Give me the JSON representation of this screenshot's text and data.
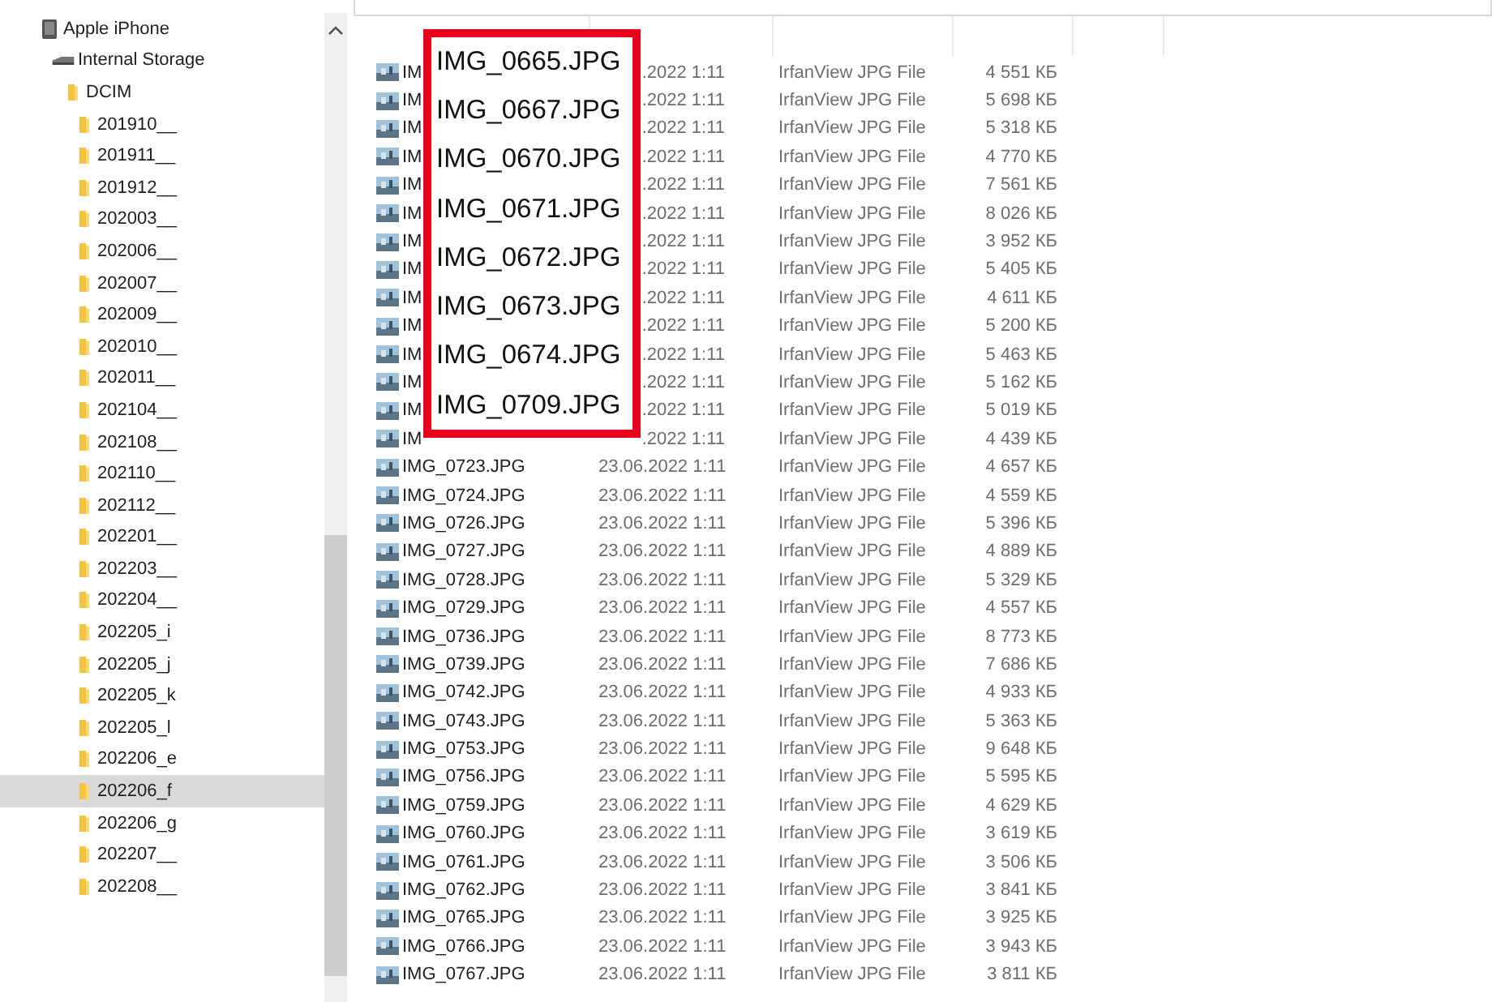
{
  "tree": [
    {
      "label": "Apple iPhone",
      "kind": "device",
      "selected": false,
      "children": [
        {
          "label": "Internal Storage",
          "kind": "drive",
          "selected": false,
          "children": [
            {
              "label": "DCIM",
              "kind": "folder",
              "selected": false,
              "children": [
                {
                  "label": "201910__",
                  "kind": "folder",
                  "selected": false
                },
                {
                  "label": "201911__",
                  "kind": "folder",
                  "selected": false
                },
                {
                  "label": "201912__",
                  "kind": "folder",
                  "selected": false
                },
                {
                  "label": "202003__",
                  "kind": "folder",
                  "selected": false
                },
                {
                  "label": "202006__",
                  "kind": "folder",
                  "selected": false
                },
                {
                  "label": "202007__",
                  "kind": "folder",
                  "selected": false
                },
                {
                  "label": "202009__",
                  "kind": "folder",
                  "selected": false
                },
                {
                  "label": "202010__",
                  "kind": "folder",
                  "selected": false
                },
                {
                  "label": "202011__",
                  "kind": "folder",
                  "selected": false
                },
                {
                  "label": "202104__",
                  "kind": "folder",
                  "selected": false
                },
                {
                  "label": "202108__",
                  "kind": "folder",
                  "selected": false
                },
                {
                  "label": "202110__",
                  "kind": "folder",
                  "selected": false
                },
                {
                  "label": "202112__",
                  "kind": "folder",
                  "selected": false
                },
                {
                  "label": "202201__",
                  "kind": "folder",
                  "selected": false
                },
                {
                  "label": "202203__",
                  "kind": "folder",
                  "selected": false
                },
                {
                  "label": "202204__",
                  "kind": "folder",
                  "selected": false
                },
                {
                  "label": "202205_i",
                  "kind": "folder",
                  "selected": false
                },
                {
                  "label": "202205_j",
                  "kind": "folder",
                  "selected": false
                },
                {
                  "label": "202205_k",
                  "kind": "folder",
                  "selected": false
                },
                {
                  "label": "202205_l",
                  "kind": "folder",
                  "selected": false
                },
                {
                  "label": "202206_e",
                  "kind": "folder",
                  "selected": false
                },
                {
                  "label": "202206_f",
                  "kind": "folder",
                  "selected": true
                },
                {
                  "label": "202206_g",
                  "kind": "folder",
                  "selected": false
                },
                {
                  "label": "202207__",
                  "kind": "folder",
                  "selected": false
                },
                {
                  "label": "202208__",
                  "kind": "folder",
                  "selected": false
                }
              ]
            }
          ]
        }
      ]
    }
  ],
  "files": [
    {
      "name": "IM",
      "modified": ".2022 1:11",
      "type": "IrfanView JPG File",
      "size": "4 551 КБ"
    },
    {
      "name": "IM",
      "modified": ".2022 1:11",
      "type": "IrfanView JPG File",
      "size": "5 698 КБ"
    },
    {
      "name": "IM",
      "modified": ".2022 1:11",
      "type": "IrfanView JPG File",
      "size": "5 318 КБ"
    },
    {
      "name": "IM",
      "modified": ".2022 1:11",
      "type": "IrfanView JPG File",
      "size": "4 770 КБ"
    },
    {
      "name": "IM",
      "modified": ".2022 1:11",
      "type": "IrfanView JPG File",
      "size": "7 561 КБ"
    },
    {
      "name": "IM",
      "modified": ".2022 1:11",
      "type": "IrfanView JPG File",
      "size": "8 026 КБ"
    },
    {
      "name": "IM",
      "modified": ".2022 1:11",
      "type": "IrfanView JPG File",
      "size": "3 952 КБ"
    },
    {
      "name": "IM",
      "modified": ".2022 1:11",
      "type": "IrfanView JPG File",
      "size": "5 405 КБ"
    },
    {
      "name": "IM",
      "modified": ".2022 1:11",
      "type": "IrfanView JPG File",
      "size": "4 611 КБ"
    },
    {
      "name": "IM",
      "modified": ".2022 1:11",
      "type": "IrfanView JPG File",
      "size": "5 200 КБ"
    },
    {
      "name": "IM",
      "modified": ".2022 1:11",
      "type": "IrfanView JPG File",
      "size": "5 463 КБ"
    },
    {
      "name": "IM",
      "modified": ".2022 1:11",
      "type": "IrfanView JPG File",
      "size": "5 162 КБ"
    },
    {
      "name": "IM",
      "modified": ".2022 1:11",
      "type": "IrfanView JPG File",
      "size": "5 019 КБ"
    },
    {
      "name": "IM",
      "modified": ".2022 1:11",
      "type": "IrfanView JPG File",
      "size": "4 439 КБ"
    },
    {
      "name": "IMG_0723.JPG",
      "modified": "23.06.2022 1:11",
      "type": "IrfanView JPG File",
      "size": "4 657 КБ"
    },
    {
      "name": "IMG_0724.JPG",
      "modified": "23.06.2022 1:11",
      "type": "IrfanView JPG File",
      "size": "4 559 КБ"
    },
    {
      "name": "IMG_0726.JPG",
      "modified": "23.06.2022 1:11",
      "type": "IrfanView JPG File",
      "size": "5 396 КБ"
    },
    {
      "name": "IMG_0727.JPG",
      "modified": "23.06.2022 1:11",
      "type": "IrfanView JPG File",
      "size": "4 889 КБ"
    },
    {
      "name": "IMG_0728.JPG",
      "modified": "23.06.2022 1:11",
      "type": "IrfanView JPG File",
      "size": "5 329 КБ"
    },
    {
      "name": "IMG_0729.JPG",
      "modified": "23.06.2022 1:11",
      "type": "IrfanView JPG File",
      "size": "4 557 КБ"
    },
    {
      "name": "IMG_0736.JPG",
      "modified": "23.06.2022 1:11",
      "type": "IrfanView JPG File",
      "size": "8 773 КБ"
    },
    {
      "name": "IMG_0739.JPG",
      "modified": "23.06.2022 1:11",
      "type": "IrfanView JPG File",
      "size": "7 686 КБ"
    },
    {
      "name": "IMG_0742.JPG",
      "modified": "23.06.2022 1:11",
      "type": "IrfanView JPG File",
      "size": "4 933 КБ"
    },
    {
      "name": "IMG_0743.JPG",
      "modified": "23.06.2022 1:11",
      "type": "IrfanView JPG File",
      "size": "5 363 КБ"
    },
    {
      "name": "IMG_0753.JPG",
      "modified": "23.06.2022 1:11",
      "type": "IrfanView JPG File",
      "size": "9 648 КБ"
    },
    {
      "name": "IMG_0756.JPG",
      "modified": "23.06.2022 1:11",
      "type": "IrfanView JPG File",
      "size": "5 595 КБ"
    },
    {
      "name": "IMG_0759.JPG",
      "modified": "23.06.2022 1:11",
      "type": "IrfanView JPG File",
      "size": "4 629 КБ"
    },
    {
      "name": "IMG_0760.JPG",
      "modified": "23.06.2022 1:11",
      "type": "IrfanView JPG File",
      "size": "3 619 КБ"
    },
    {
      "name": "IMG_0761.JPG",
      "modified": "23.06.2022 1:11",
      "type": "IrfanView JPG File",
      "size": "3 506 КБ"
    },
    {
      "name": "IMG_0762.JPG",
      "modified": "23.06.2022 1:11",
      "type": "IrfanView JPG File",
      "size": "3 841 КБ"
    },
    {
      "name": "IMG_0765.JPG",
      "modified": "23.06.2022 1:11",
      "type": "IrfanView JPG File",
      "size": "3 925 КБ"
    },
    {
      "name": "IMG_0766.JPG",
      "modified": "23.06.2022 1:11",
      "type": "IrfanView JPG File",
      "size": "3 943 КБ"
    },
    {
      "name": "IMG_0767.JPG",
      "modified": "23.06.2022 1:11",
      "type": "IrfanView JPG File",
      "size": "3 811 КБ"
    }
  ],
  "callout": {
    "labels": [
      "IMG_0665.JPG",
      "IMG_0667.JPG",
      "IMG_0670.JPG",
      "IMG_0671.JPG",
      "IMG_0672.JPG",
      "IMG_0673.JPG",
      "IMG_0674.JPG",
      "IMG_0709.JPG"
    ]
  }
}
